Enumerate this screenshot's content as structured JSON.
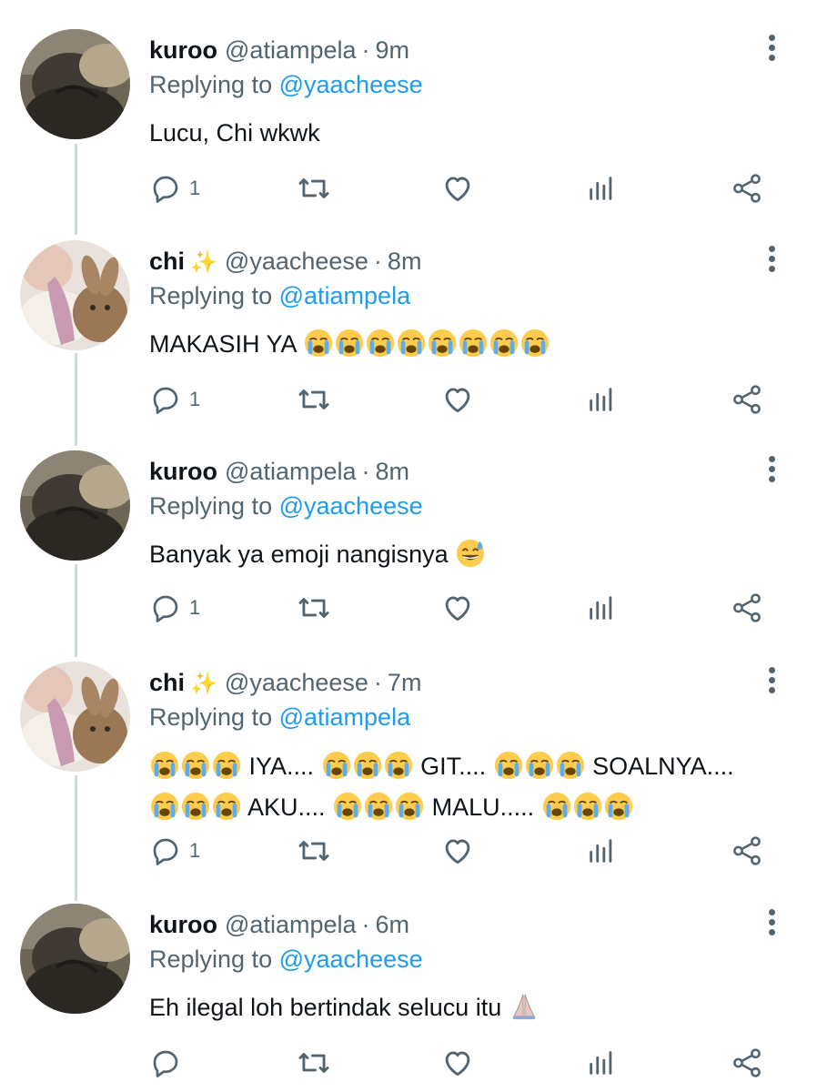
{
  "tweets": [
    {
      "display_name": "kuroo",
      "sparkle": "",
      "handle": "@atiampela",
      "time": "9m",
      "replying_prefix": "Replying to",
      "replying_to": "@yaacheese",
      "text_segments": [
        "Lucu, Chi wkwk"
      ],
      "reply_count": "1",
      "avatar": "cat-avatar-icon"
    },
    {
      "display_name": "chi",
      "sparkle": "✨",
      "handle": "@yaacheese",
      "time": "8m",
      "replying_prefix": "Replying to",
      "replying_to": "@atiampela",
      "text_segments": [
        "MAKASIH YA"
      ],
      "reply_count": "1",
      "avatar": "bunny-plush-avatar-icon"
    },
    {
      "display_name": "kuroo",
      "sparkle": "",
      "handle": "@atiampela",
      "time": "8m",
      "replying_prefix": "Replying to",
      "replying_to": "@yaacheese",
      "text_segments": [
        "Banyak ya emoji nangisnya"
      ],
      "reply_count": "1",
      "avatar": "cat-avatar-icon"
    },
    {
      "display_name": "chi",
      "sparkle": "✨",
      "handle": "@yaacheese",
      "time": "7m",
      "replying_prefix": "Replying to",
      "replying_to": "@atiampela",
      "text_segments": [
        "IYA....",
        "GIT....",
        "SOALNYA....",
        "AKU....",
        "MALU....."
      ],
      "reply_count": "1",
      "avatar": "bunny-plush-avatar-icon"
    },
    {
      "display_name": "kuroo",
      "sparkle": "",
      "handle": "@atiampela",
      "time": "6m",
      "replying_prefix": "Replying to",
      "replying_to": "@yaacheese",
      "text_segments": [
        "Eh ilegal loh bertindak selucu itu"
      ],
      "reply_count": "",
      "avatar": "cat-avatar-icon"
    }
  ],
  "separator": "·",
  "colors": {
    "text": "#0f1419",
    "secondary": "#536471",
    "link": "#1d9bf0",
    "thread_line": "#cfd9de"
  },
  "icons": {
    "reply": "reply-icon",
    "retweet": "retweet-icon",
    "like": "heart-icon",
    "views": "views-icon",
    "share": "share-icon",
    "more": "more-options-icon",
    "crying": "loudly-crying-face-icon",
    "sweat_smile": "grinning-sweat-face-icon",
    "pray": "folded-hands-icon"
  }
}
